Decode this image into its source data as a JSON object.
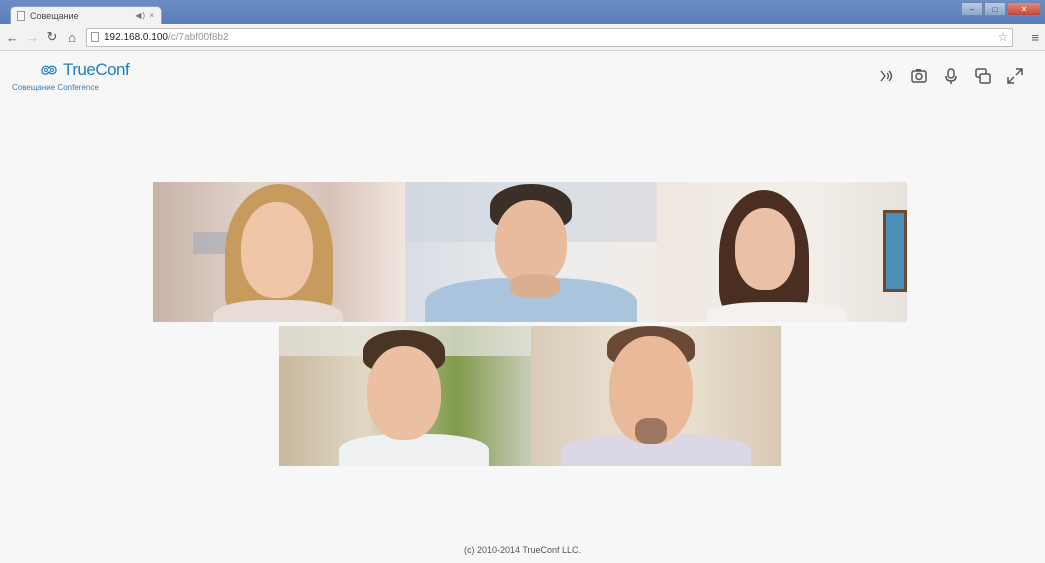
{
  "browser": {
    "tab_title": "Совещание",
    "tab_extra": "◀) ×",
    "url_host": "192.168.0.100",
    "url_path": "/c/7abf00f8b2",
    "icons": [
      "back-arrow-icon",
      "forward-arrow-icon",
      "reload-icon",
      "home-icon",
      "page-icon",
      "star-icon",
      "menu-icon"
    ]
  },
  "app": {
    "logo_text": "TrueConf",
    "logo_subtitle": "Совещание Conference",
    "brand_color": "#1f7fc0",
    "controls": [
      {
        "name": "speaker-icon"
      },
      {
        "name": "camera-icon"
      },
      {
        "name": "microphone-icon"
      },
      {
        "name": "layout-icon"
      },
      {
        "name": "fullscreen-icon"
      }
    ],
    "participants_count": 5,
    "footer": "(c) 2010-2014 TrueConf LLC."
  }
}
